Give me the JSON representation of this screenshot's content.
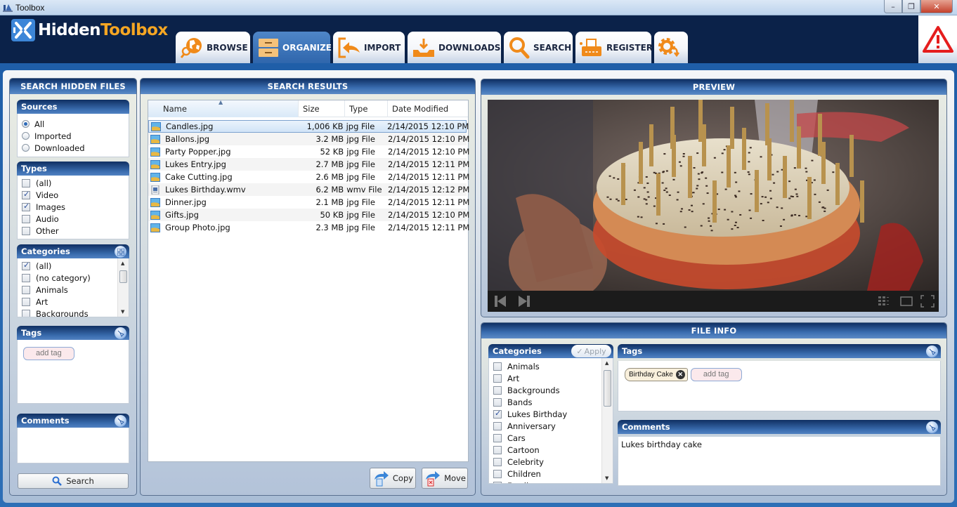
{
  "window": {
    "title": "Toolbox",
    "min_label": "–",
    "restore_label": "❐",
    "close_label": "✕"
  },
  "brand": {
    "part1": "Hidden",
    "part2": "Toolbox"
  },
  "tabs": [
    {
      "label": "BROWSE",
      "icon": "browse-globe-icon",
      "active": false
    },
    {
      "label": "ORGANIZE",
      "icon": "organize-drawer-icon",
      "active": true
    },
    {
      "label": "IMPORT",
      "icon": "import-arrow-icon",
      "active": false
    },
    {
      "label": "DOWNLOADS",
      "icon": "downloads-tray-icon",
      "active": false
    },
    {
      "label": "SEARCH",
      "icon": "search-icon",
      "active": false
    },
    {
      "label": "REGISTER",
      "icon": "register-typewriter-icon",
      "active": false
    },
    {
      "label": "",
      "icon": "settings-gear-icon",
      "active": false
    }
  ],
  "alert_icon": "warning-triangle-icon",
  "search_panel": {
    "title": "SEARCH HIDDEN FILES",
    "sources": {
      "title": "Sources",
      "options": [
        "All",
        "Imported",
        "Downloaded"
      ],
      "selected": "All"
    },
    "types": {
      "title": "Types",
      "items": [
        {
          "label": "(all)",
          "checked": false
        },
        {
          "label": "Video",
          "checked": true
        },
        {
          "label": "Images",
          "checked": true
        },
        {
          "label": "Audio",
          "checked": false
        },
        {
          "label": "Other",
          "checked": false
        }
      ]
    },
    "categories": {
      "title": "Categories",
      "items": [
        {
          "label": "(all)",
          "checked": true
        },
        {
          "label": "(no category)",
          "checked": false
        },
        {
          "label": "Animals",
          "checked": false
        },
        {
          "label": "Art",
          "checked": false
        },
        {
          "label": "Backgrounds",
          "checked": false
        }
      ]
    },
    "tags": {
      "title": "Tags",
      "add_tag": "add tag"
    },
    "comments": {
      "title": "Comments",
      "value": ""
    },
    "search_button": "Search"
  },
  "results": {
    "title": "SEARCH RESULTS",
    "columns": [
      "Name",
      "Size",
      "Type",
      "Date Modified"
    ],
    "rows": [
      {
        "name": "Candles.jpg",
        "size": "1,006 KB",
        "type": "jpg File",
        "date": "2/14/2015 12:10 PM",
        "selected": true
      },
      {
        "name": "Ballons.jpg",
        "size": "3.2 MB",
        "type": "jpg File",
        "date": "2/14/2015 12:10 PM"
      },
      {
        "name": "Party Popper.jpg",
        "size": "52 KB",
        "type": "jpg File",
        "date": "2/14/2015 12:10 PM"
      },
      {
        "name": "Lukes Entry.jpg",
        "size": "2.7 MB",
        "type": "jpg File",
        "date": "2/14/2015 12:11 PM"
      },
      {
        "name": "Cake Cutting.jpg",
        "size": "2.6 MB",
        "type": "jpg File",
        "date": "2/14/2015 12:11 PM"
      },
      {
        "name": "Lukes Birthday.wmv",
        "size": "6.2 MB",
        "type": "wmv File",
        "date": "2/14/2015 12:12 PM"
      },
      {
        "name": "Dinner.jpg",
        "size": "2.1 MB",
        "type": "jpg File",
        "date": "2/14/2015 12:11 PM"
      },
      {
        "name": "Gifts.jpg",
        "size": "50 KB",
        "type": "jpg File",
        "date": "2/14/2015 12:10 PM"
      },
      {
        "name": "Group Photo.jpg",
        "size": "2.3 MB",
        "type": "jpg File",
        "date": "2/14/2015 12:11 PM"
      }
    ],
    "copy_button": "Copy",
    "move_button": "Move"
  },
  "preview": {
    "title": "PREVIEW",
    "image_desc": "Birthday cake with golden candles held in hands"
  },
  "file_info": {
    "title": "FILE INFO",
    "categories": {
      "title": "Categories",
      "apply_label": "Apply",
      "items": [
        {
          "label": "Animals",
          "checked": false
        },
        {
          "label": "Art",
          "checked": false
        },
        {
          "label": "Backgrounds",
          "checked": false
        },
        {
          "label": "Bands",
          "checked": false
        },
        {
          "label": "Lukes Birthday",
          "checked": true
        },
        {
          "label": "Anniversary",
          "checked": false
        },
        {
          "label": "Cars",
          "checked": false
        },
        {
          "label": "Cartoon",
          "checked": false
        },
        {
          "label": "Celebrity",
          "checked": false
        },
        {
          "label": "Children",
          "checked": false
        },
        {
          "label": "Family",
          "checked": false
        }
      ]
    },
    "tags": {
      "title": "Tags",
      "chips": [
        "Birthday Cake"
      ],
      "add_tag": "add tag"
    },
    "comments": {
      "title": "Comments",
      "value": "Lukes birthday cake"
    }
  },
  "colors": {
    "header_bg": "#0b2249",
    "accent_orange": "#f5a623",
    "panel_header": "#2f62a6",
    "active_tab": "#3a72b8"
  }
}
